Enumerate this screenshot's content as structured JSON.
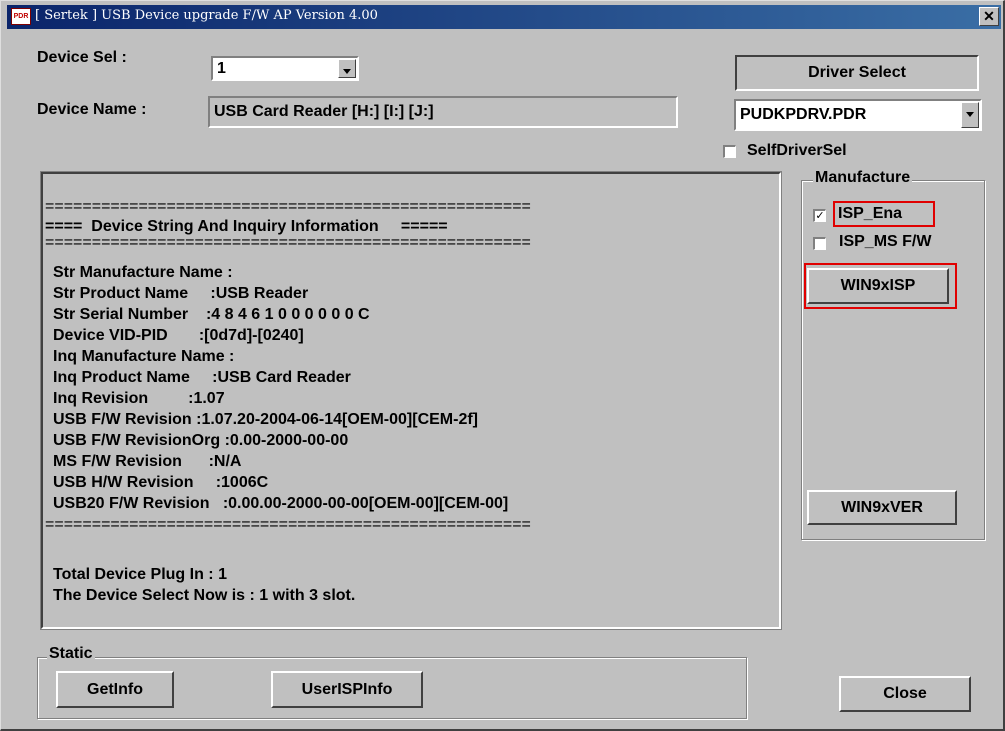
{
  "window": {
    "icon_text": "PDR",
    "title": "[ Sertek ] USB Device upgrade F/W  AP  Version 4.00",
    "close_glyph": "✕"
  },
  "device_sel": {
    "label": "Device Sel  :",
    "value": "1"
  },
  "device_name": {
    "label": "Device Name :",
    "value": "USB Card Reader [H:] [I:] [J:]"
  },
  "driver": {
    "button_label": "Driver Select",
    "dropdown_value": "PUDKPDRV.PDR",
    "self_driver_label": "SelfDriverSel",
    "self_driver_checked": false
  },
  "manufacture": {
    "title": "Manufacture",
    "isp_ena_label": "ISP_Ena",
    "isp_ena_checked": true,
    "isp_ms_label": "ISP_MS F/W",
    "isp_ms_checked": false,
    "win9xisp_label": "WIN9xISP",
    "win9xver_label": "WIN9xVER"
  },
  "info": {
    "separator": "====================================================",
    "lines": [
      "====  Device String And Inquiry Information     =====",
      "Str Manufacture Name :",
      "Str Product Name     :USB Reader",
      "Str Serial Number    :4 8 4 6 1 0 0 0 0 0 0 C",
      "Device VID-PID       :[0d7d]-[0240]",
      "Inq Manufacture Name :",
      "Inq Product Name     :USB Card Reader",
      "Inq Revision         :1.07",
      "USB F/W Revision :1.07.20-2004-06-14[OEM-00][CEM-2f]",
      "USB F/W RevisionOrg :0.00-2000-00-00",
      "MS F/W Revision      :N/A",
      "USB H/W Revision     :1006C",
      "USB20 F/W Revision   :0.00.00-2000-00-00[OEM-00][CEM-00]",
      "Total Device Plug In : 1",
      "The Device Select Now is : 1 with 3 slot."
    ]
  },
  "static_group": {
    "title": "Static",
    "getinfo_label": "GetInfo",
    "userispinfo_label": "UserISPInfo"
  },
  "close_label": "Close"
}
